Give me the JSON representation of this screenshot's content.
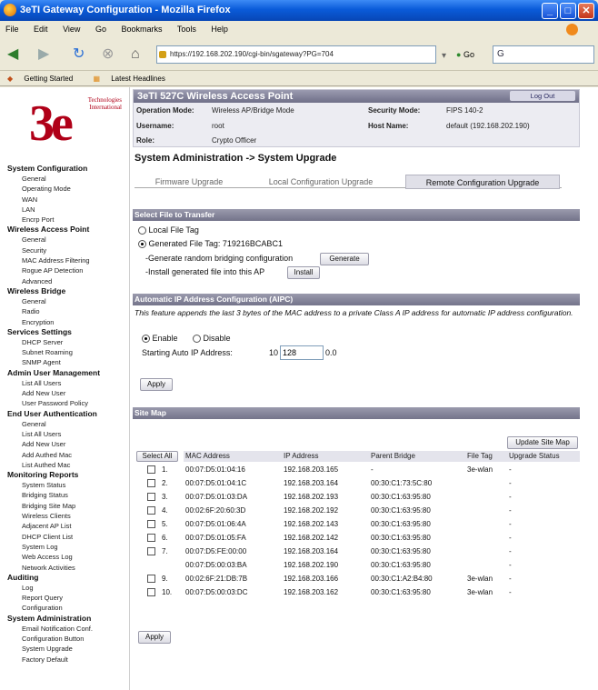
{
  "window": {
    "title": "3eTI Gateway Configuration - Mozilla Firefox",
    "minimize": "_",
    "maximize": "□",
    "close": "✕"
  },
  "menu": [
    "File",
    "Edit",
    "View",
    "Go",
    "Bookmarks",
    "Tools",
    "Help"
  ],
  "nav": {
    "url": "https://192.168.202.190/cgi-bin/sgateway?PG=704",
    "go_label": "Go",
    "search_value": "G"
  },
  "bookmarks": [
    "Getting Started",
    "Latest Headlines"
  ],
  "logo": {
    "mark": "3e",
    "company": "Technologies International"
  },
  "sidebar": [
    {
      "title": "System Configuration",
      "items": [
        "General",
        "Operating Mode",
        "WAN",
        "LAN",
        "Encrp Port"
      ]
    },
    {
      "title": "Wireless Access Point",
      "items": [
        "General",
        "Security",
        "MAC Address Filtering",
        "Rogue AP Detection",
        "Advanced"
      ]
    },
    {
      "title": "Wireless Bridge",
      "items": [
        "General",
        "Radio",
        "Encryption"
      ]
    },
    {
      "title": "Services Settings",
      "items": [
        "DHCP Server",
        "Subnet Roaming",
        "SNMP Agent"
      ]
    },
    {
      "title": "Admin User Management",
      "items": [
        "List All Users",
        "Add New User",
        "User Password Policy"
      ]
    },
    {
      "title": "End User Authentication",
      "items": [
        "General",
        "List All Users",
        "Add New User",
        "Add Authed Mac",
        "List Authed Mac"
      ]
    },
    {
      "title": "Monitoring Reports",
      "items": [
        "System Status",
        "Bridging Status",
        "Bridging Site Map",
        "Wireless Clients",
        "Adjacent AP List",
        "DHCP Client List",
        "System Log",
        "Web Access Log",
        "Network Activities"
      ]
    },
    {
      "title": "Auditing",
      "items": [
        "Log",
        "Report Query",
        "Configuration"
      ]
    },
    {
      "title": "System Administration",
      "items": [
        "Email Notification Conf.",
        "Configuration Button",
        "System Upgrade",
        "Factory Default"
      ]
    }
  ],
  "header": {
    "title": "3eTI 527C Wireless Access Point",
    "logout": "Log Out",
    "operation_mode_label": "Operation Mode:",
    "operation_mode": "Wireless AP/Bridge Mode",
    "security_mode_label": "Security Mode:",
    "security_mode": "FIPS 140-2",
    "username_label": "Username:",
    "username": "root",
    "host_name_label": "Host Name:",
    "host_name": "default (192.168.202.190)",
    "role_label": "Role:",
    "role": "Crypto Officer"
  },
  "page_title": "System Administration -> System Upgrade",
  "tabs": [
    "Firmware Upgrade",
    "Local Configuration Upgrade",
    "Remote Configuration Upgrade"
  ],
  "active_tab": 2,
  "select_file": {
    "header": "Select File to Transfer",
    "local_file_tag": "Local File Tag",
    "generated_file_tag": "Generated File Tag: 719216BCABC1",
    "generate_text": "-Generate random bridging configuration",
    "generate_button": "Generate",
    "install_text": "-Install generated file into this AP",
    "install_button": "Install"
  },
  "aipc": {
    "header": "Automatic IP Address Configuration (AIPC)",
    "description": "This feature appends the last 3 bytes of the MAC address to a private Class A IP address for automatic IP address configuration.",
    "enable": "Enable",
    "disable": "Disable",
    "starting_label": "Starting Auto IP Address:",
    "ip_prefix": "10",
    "ip_octet": "128",
    "ip_suffix": "0.0",
    "apply": "Apply"
  },
  "site_map": {
    "header": "Site Map",
    "update_button": "Update Site Map",
    "select_all": "Select All",
    "columns": [
      "MAC Address",
      "IP Address",
      "Parent Bridge",
      "File Tag",
      "Upgrade Status"
    ],
    "rows": [
      {
        "num": "1.",
        "checkbox": true,
        "mac": "00:07:D5:01:04:16",
        "ip": "192.168.203.165",
        "parent": "-",
        "tag": "3e-wlan",
        "status": "-"
      },
      {
        "num": "2.",
        "checkbox": true,
        "mac": "00:07:D5:01:04:1C",
        "ip": "192.168.203.164",
        "parent": "00:30:C1:73:5C:80",
        "tag": "",
        "status": "-"
      },
      {
        "num": "3.",
        "checkbox": true,
        "mac": "00:07:D5:01:03:DA",
        "ip": "192.168.202.193",
        "parent": "00:30:C1:63:95:80",
        "tag": "",
        "status": "-"
      },
      {
        "num": "4.",
        "checkbox": true,
        "mac": "00:02:6F:20:60:3D",
        "ip": "192.168.202.192",
        "parent": "00:30:C1:63:95:80",
        "tag": "",
        "status": "-"
      },
      {
        "num": "5.",
        "checkbox": true,
        "mac": "00:07:D5:01:06:4A",
        "ip": "192.168.202.143",
        "parent": "00:30:C1:63:95:80",
        "tag": "",
        "status": "-"
      },
      {
        "num": "6.",
        "checkbox": true,
        "mac": "00:07:D5:01:05:FA",
        "ip": "192.168.202.142",
        "parent": "00:30:C1:63:95:80",
        "tag": "",
        "status": "-"
      },
      {
        "num": "7.",
        "checkbox": true,
        "mac": "00:07:D5:FE:00:00",
        "ip": "192.168.203.164",
        "parent": "00:30:C1:63:95:80",
        "tag": "",
        "status": "-"
      },
      {
        "num": "",
        "checkbox": false,
        "mac": "00:07:D5:00:03:BA",
        "ip": "192.168.202.190",
        "parent": "00:30:C1:63:95:80",
        "tag": "",
        "status": "-"
      },
      {
        "num": "9.",
        "checkbox": true,
        "mac": "00:02:6F:21:DB:7B",
        "ip": "192.168.203.166",
        "parent": "00:30:C1:A2:B4:80",
        "tag": "3e-wlan",
        "status": "-"
      },
      {
        "num": "10.",
        "checkbox": true,
        "mac": "00:07:D5:00:03:DC",
        "ip": "192.168.203.162",
        "parent": "00:30:C1:63:95:80",
        "tag": "3e-wlan",
        "status": "-"
      }
    ],
    "apply": "Apply"
  },
  "colors": {
    "accent": "#7a7a90",
    "logo": "#b00018",
    "title_bar": "#0a5bd9"
  }
}
